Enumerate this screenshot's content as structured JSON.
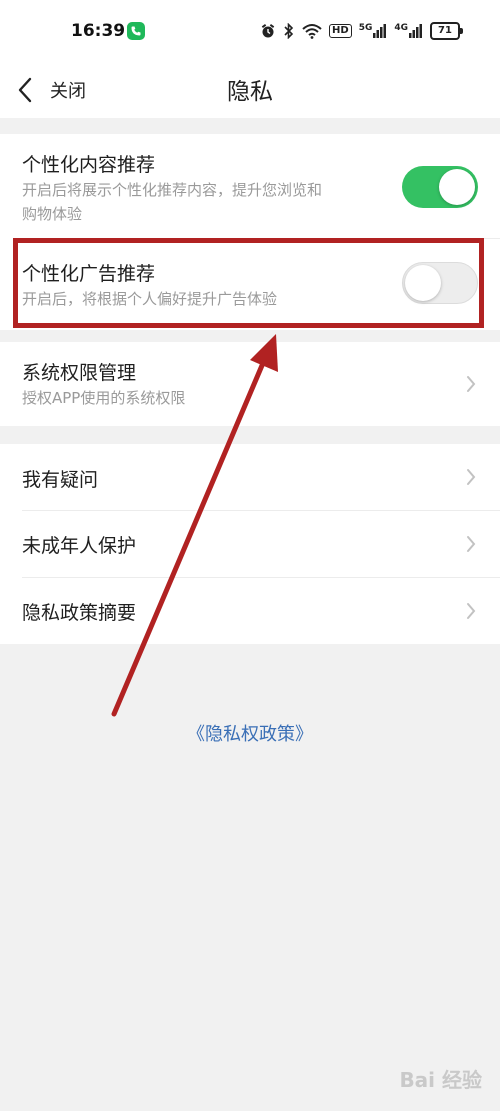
{
  "status_bar": {
    "time": "16:39",
    "battery": "71",
    "hd_label": "HD",
    "signal_labels": [
      "5G",
      "4G"
    ]
  },
  "nav": {
    "back_label": "关闭",
    "title": "隐私"
  },
  "sections": {
    "personalized_content": {
      "title": "个性化内容推荐",
      "subtitle_line1": "开启后将展示个性化推荐内容，提升您浏览和",
      "subtitle_line2": "购物体验",
      "enabled": true
    },
    "personalized_ads": {
      "title": "个性化广告推荐",
      "subtitle": "开启后，将根据个人偏好提升广告体验",
      "enabled": false
    },
    "system_permissions": {
      "title": "系统权限管理",
      "subtitle": "授权APP使用的系统权限"
    },
    "help_items": [
      {
        "label": "我有疑问"
      },
      {
        "label": "未成年人保护"
      },
      {
        "label": "隐私政策摘要"
      }
    ]
  },
  "footer": {
    "policy_link": "《隐私权政策》"
  },
  "watermark": "Bai 经验",
  "colors": {
    "toggle_on": "#34c163",
    "highlight": "#b12222",
    "link": "#3a6fb6"
  }
}
